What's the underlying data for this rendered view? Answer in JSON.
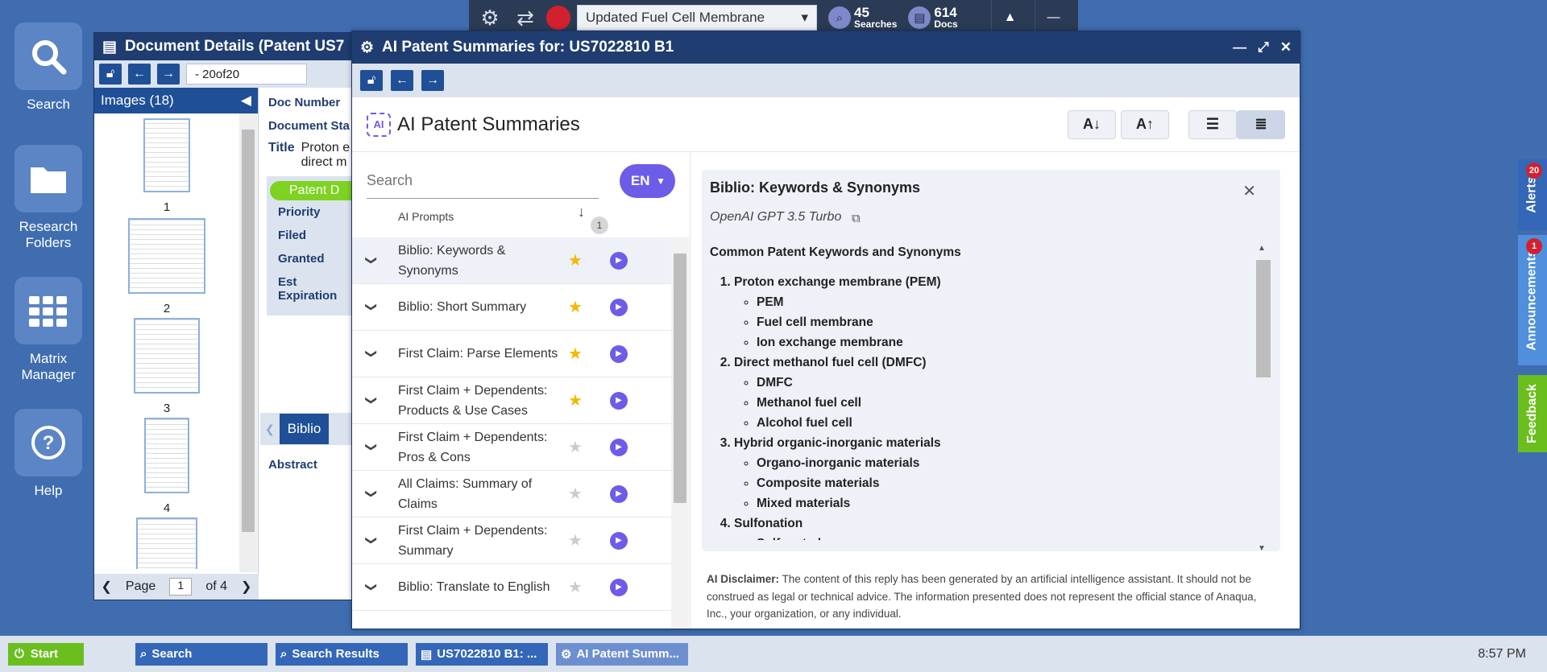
{
  "topbar": {
    "search_name": "Updated Fuel Cell Membrane",
    "searches_count": "45",
    "searches_label": "Searches",
    "docs_count": "614",
    "docs_label": "Docs"
  },
  "desktop": {
    "search": "Search",
    "research_folders_1": "Research",
    "research_folders_2": "Folders",
    "matrix_manager_1": "Matrix",
    "matrix_manager_2": "Manager",
    "help": "Help"
  },
  "doc_window": {
    "title": "Document Details (Patent US7",
    "page_field": "- 20of20",
    "images_label": "Images (18)",
    "thumb_labels": [
      "1",
      "2",
      "3",
      "4"
    ],
    "pager_label": "Page",
    "pager_value": "1",
    "pager_of": "of 4",
    "fields": {
      "doc_number": "Doc Number",
      "document_status": "Document Sta",
      "title_label": "Title",
      "title_value_1": "Proton e",
      "title_value_2": "direct m",
      "patent_pill": "Patent D",
      "priority": "Priority",
      "filed": "Filed",
      "granted": "Granted",
      "est_expiration": "Est Expiration",
      "abstract": "Abstract"
    },
    "tab_biblio": "Biblio"
  },
  "ai_window": {
    "title": "AI Patent Summaries for: US7022810 B1",
    "header": "AI Patent Summaries",
    "logo_text": "AI",
    "font_down": "A↓",
    "font_up": "A↑",
    "search_placeholder": "Search",
    "lang": "EN",
    "prompts_header": "AI Prompts",
    "sort_badge": "1",
    "prompts": [
      {
        "label": "Biblio: Keywords & Synonyms",
        "starred": true
      },
      {
        "label": "Biblio: Short Summary",
        "starred": true
      },
      {
        "label": "First Claim: Parse Elements",
        "starred": true
      },
      {
        "label": "First Claim + Dependents: Products & Use Cases",
        "starred": true
      },
      {
        "label": "First Claim + Dependents: Pros & Cons",
        "starred": false
      },
      {
        "label": "All Claims: Summary of Claims",
        "starred": false
      },
      {
        "label": "First Claim + Dependents: Summary",
        "starred": false
      },
      {
        "label": "Biblio: Translate to English",
        "starred": false
      }
    ],
    "result": {
      "title": "Biblio: Keywords & Synonyms",
      "model": "OpenAI GPT 3.5 Turbo",
      "heading": "Common Patent Keywords and Synonyms",
      "items": [
        {
          "term": "Proton exchange membrane (PEM)",
          "synonyms": [
            "PEM",
            "Fuel cell membrane",
            "Ion exchange membrane"
          ]
        },
        {
          "term": "Direct methanol fuel cell (DMFC)",
          "synonyms": [
            "DMFC",
            "Methanol fuel cell",
            "Alcohol fuel cell"
          ]
        },
        {
          "term": "Hybrid organic-inorganic materials",
          "synonyms": [
            "Organo-inorganic materials",
            "Composite materials",
            "Mixed materials"
          ]
        },
        {
          "term": "Sulfonation",
          "synonyms": [
            "Sulfonated"
          ]
        }
      ]
    },
    "disclaimer_label": "AI Disclaimer:",
    "disclaimer_text": " The content of this reply has been generated by an artificial intelligence assistant. It should not be construed as legal or technical advice. The information presented does not represent the official stance of Anaqua, Inc., your organization, or any individual."
  },
  "side_tabs": {
    "alerts": "Alerts",
    "alerts_count": "20",
    "announcements": "Announcements",
    "announcements_count": "1",
    "feedback": "Feedback"
  },
  "taskbar": {
    "start": "Start",
    "tasks": [
      "Search",
      "Search Results",
      "US7022810 B1: ...",
      "AI Patent Summ..."
    ],
    "clock": "8:57 PM"
  },
  "colors": {
    "accent": "#6d5ce7",
    "window_title": "#1f3d70",
    "desktop": "#3f6db0",
    "star": "#f5b800"
  }
}
